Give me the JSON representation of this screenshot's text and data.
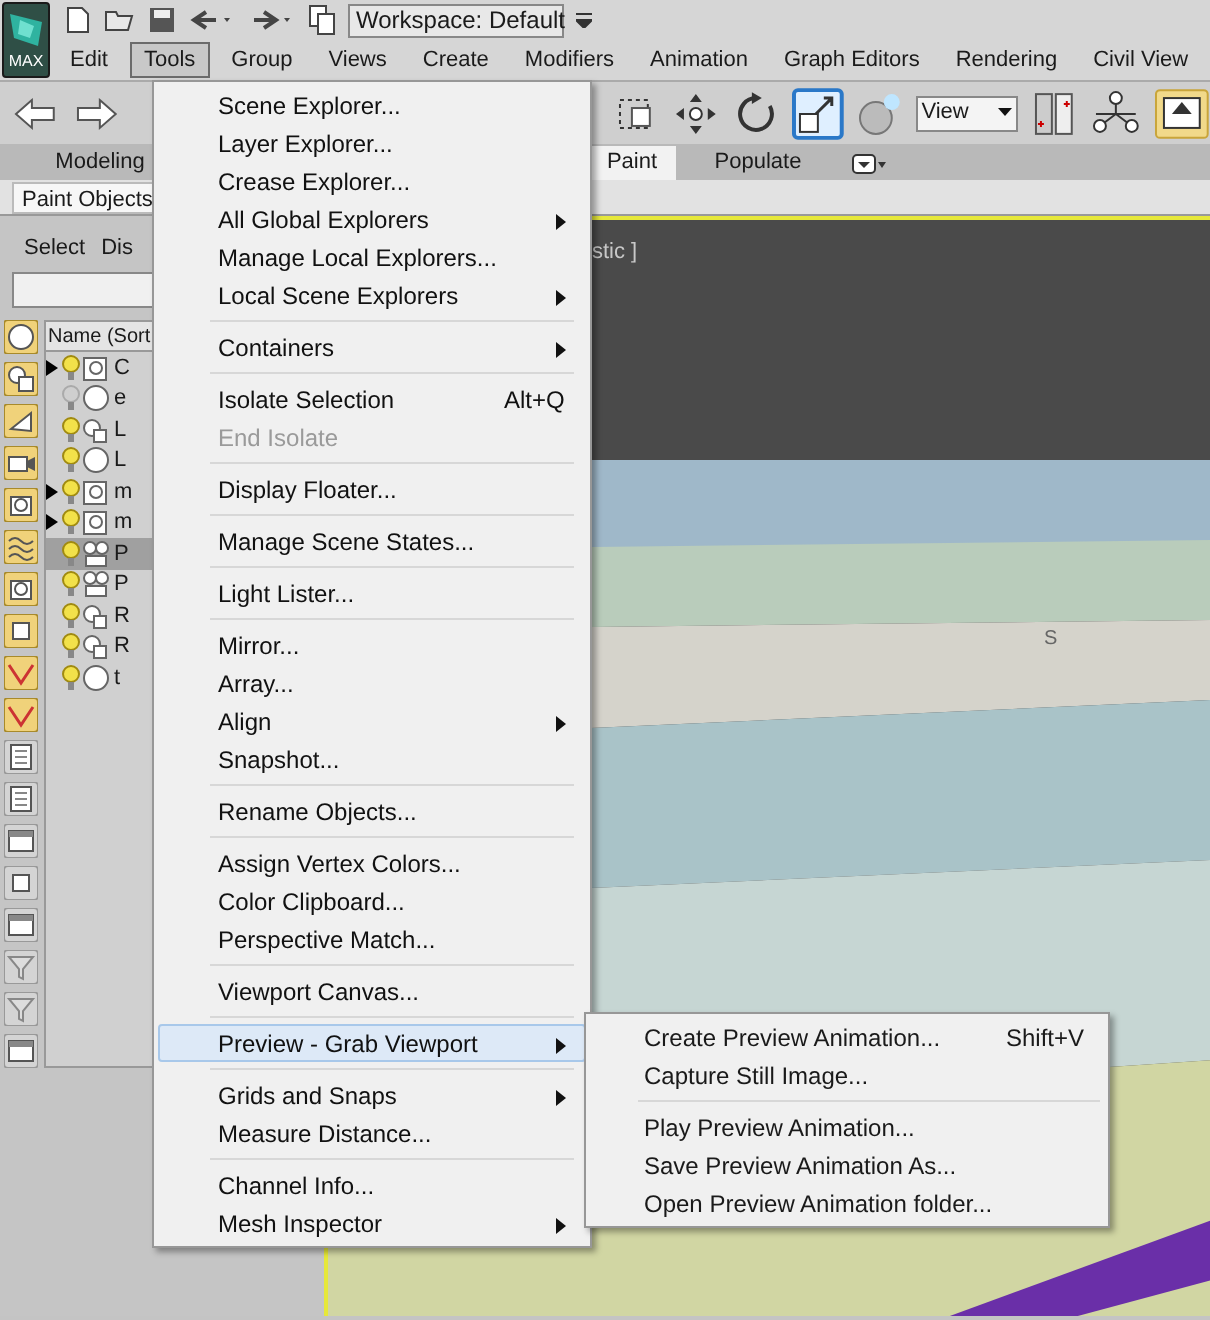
{
  "app_button": {
    "label": "MAX"
  },
  "workspace": {
    "value": "Workspace: Default"
  },
  "menu_bar": [
    {
      "label": "Edit",
      "selected": false
    },
    {
      "label": "Tools",
      "selected": true
    },
    {
      "label": "Group",
      "selected": false
    },
    {
      "label": "Views",
      "selected": false
    },
    {
      "label": "Create",
      "selected": false
    },
    {
      "label": "Modifiers",
      "selected": false
    },
    {
      "label": "Animation",
      "selected": false
    },
    {
      "label": "Graph Editors",
      "selected": false
    },
    {
      "label": "Rendering",
      "selected": false
    },
    {
      "label": "Civil View",
      "selected": false
    }
  ],
  "toolbar": {
    "view_dropdown": "View"
  },
  "ribbon_tabs": [
    {
      "label": "Modeling",
      "selected": false
    },
    {
      "label": "Paint",
      "selected": true
    },
    {
      "label": "Populate",
      "selected": false
    }
  ],
  "ribbon_panel_tab": "Paint Objects",
  "scene_explorer": {
    "tabs": [
      "Select",
      "Dis"
    ],
    "column_header": "Name (Sort",
    "filters": [
      {
        "kind": "sphere",
        "on": true
      },
      {
        "kind": "shapes",
        "on": true
      },
      {
        "kind": "cone",
        "on": true
      },
      {
        "kind": "camera",
        "on": true
      },
      {
        "kind": "box",
        "on": true
      },
      {
        "kind": "waves",
        "on": true
      },
      {
        "kind": "box",
        "on": true
      },
      {
        "kind": "square",
        "on": true
      },
      {
        "kind": "curve",
        "on": true
      },
      {
        "kind": "curve",
        "on": true
      },
      {
        "kind": "page",
        "on": false
      },
      {
        "kind": "page",
        "on": false
      },
      {
        "kind": "list",
        "on": false
      },
      {
        "kind": "square",
        "on": false
      },
      {
        "kind": "list",
        "on": false
      },
      {
        "kind": "filter",
        "on": false
      },
      {
        "kind": "filter",
        "on": false
      },
      {
        "kind": "list",
        "on": false
      }
    ],
    "rows": [
      {
        "label": "C",
        "kind": "helper",
        "expandable": true,
        "visible": true,
        "selected": false
      },
      {
        "label": "e",
        "kind": "sphere",
        "expandable": false,
        "visible": false,
        "selected": false
      },
      {
        "label": "L",
        "kind": "light",
        "expandable": false,
        "visible": true,
        "selected": false
      },
      {
        "label": "L",
        "kind": "sphere",
        "expandable": false,
        "visible": true,
        "selected": false
      },
      {
        "label": "m",
        "kind": "helper",
        "expandable": true,
        "visible": true,
        "selected": false
      },
      {
        "label": "m",
        "kind": "helper",
        "expandable": true,
        "visible": true,
        "selected": false
      },
      {
        "label": "P",
        "kind": "camera",
        "expandable": false,
        "visible": true,
        "selected": true
      },
      {
        "label": "P",
        "kind": "camera",
        "expandable": false,
        "visible": true,
        "selected": false
      },
      {
        "label": "R",
        "kind": "light",
        "expandable": false,
        "visible": true,
        "selected": false
      },
      {
        "label": "R",
        "kind": "light",
        "expandable": false,
        "visible": true,
        "selected": false
      },
      {
        "label": "t",
        "kind": "sphere",
        "expandable": false,
        "visible": true,
        "selected": false
      }
    ]
  },
  "viewport": {
    "label": "stic ]",
    "compass_label": "S"
  },
  "tools_menu": [
    {
      "label": "Scene Explorer...",
      "submenu": false,
      "disabled": false,
      "highlighted": false,
      "separator_after": false
    },
    {
      "label": "Layer Explorer...",
      "submenu": false,
      "disabled": false,
      "highlighted": false,
      "separator_after": false
    },
    {
      "label": "Crease Explorer...",
      "submenu": false,
      "disabled": false,
      "highlighted": false,
      "separator_after": false
    },
    {
      "label": "All Global Explorers",
      "submenu": true,
      "disabled": false,
      "highlighted": false,
      "separator_after": false
    },
    {
      "label": "Manage Local Explorers...",
      "submenu": false,
      "disabled": false,
      "highlighted": false,
      "separator_after": false
    },
    {
      "label": "Local Scene Explorers",
      "submenu": true,
      "disabled": false,
      "highlighted": false,
      "separator_after": true
    },
    {
      "label": "Containers",
      "submenu": true,
      "disabled": false,
      "highlighted": false,
      "separator_after": true
    },
    {
      "label": "Isolate Selection",
      "shortcut": "Alt+Q",
      "submenu": false,
      "disabled": false,
      "highlighted": false,
      "separator_after": false
    },
    {
      "label": "End Isolate",
      "submenu": false,
      "disabled": true,
      "highlighted": false,
      "separator_after": true
    },
    {
      "label": "Display Floater...",
      "submenu": false,
      "disabled": false,
      "highlighted": false,
      "separator_after": true
    },
    {
      "label": "Manage Scene States...",
      "submenu": false,
      "disabled": false,
      "highlighted": false,
      "separator_after": true
    },
    {
      "label": "Light Lister...",
      "submenu": false,
      "disabled": false,
      "highlighted": false,
      "separator_after": true
    },
    {
      "label": "Mirror...",
      "submenu": false,
      "disabled": false,
      "highlighted": false,
      "separator_after": false
    },
    {
      "label": "Array...",
      "submenu": false,
      "disabled": false,
      "highlighted": false,
      "separator_after": false
    },
    {
      "label": "Align",
      "submenu": true,
      "disabled": false,
      "highlighted": false,
      "separator_after": false
    },
    {
      "label": "Snapshot...",
      "submenu": false,
      "disabled": false,
      "highlighted": false,
      "separator_after": true
    },
    {
      "label": "Rename Objects...",
      "submenu": false,
      "disabled": false,
      "highlighted": false,
      "separator_after": true
    },
    {
      "label": "Assign Vertex Colors...",
      "submenu": false,
      "disabled": false,
      "highlighted": false,
      "separator_after": false
    },
    {
      "label": "Color Clipboard...",
      "submenu": false,
      "disabled": false,
      "highlighted": false,
      "separator_after": false
    },
    {
      "label": "Perspective Match...",
      "submenu": false,
      "disabled": false,
      "highlighted": false,
      "separator_after": true
    },
    {
      "label": "Viewport Canvas...",
      "submenu": false,
      "disabled": false,
      "highlighted": false,
      "separator_after": true
    },
    {
      "label": "Preview - Grab Viewport",
      "submenu": true,
      "disabled": false,
      "highlighted": true,
      "separator_after": true
    },
    {
      "label": "Grids and Snaps",
      "submenu": true,
      "disabled": false,
      "highlighted": false,
      "separator_after": false
    },
    {
      "label": "Measure Distance...",
      "submenu": false,
      "disabled": false,
      "highlighted": false,
      "separator_after": true
    },
    {
      "label": "Channel Info...",
      "submenu": false,
      "disabled": false,
      "highlighted": false,
      "separator_after": false
    },
    {
      "label": "Mesh Inspector",
      "submenu": true,
      "disabled": false,
      "highlighted": false,
      "separator_after": false
    }
  ],
  "preview_submenu": [
    {
      "label": "Create Preview Animation...",
      "shortcut": "Shift+V",
      "separator_after": false
    },
    {
      "label": "Capture Still Image...",
      "separator_after": true
    },
    {
      "label": "Play Preview Animation...",
      "separator_after": false
    },
    {
      "label": "Save Preview Animation As...",
      "separator_after": false
    },
    {
      "label": "Open Preview Animation folder...",
      "separator_after": false
    }
  ]
}
